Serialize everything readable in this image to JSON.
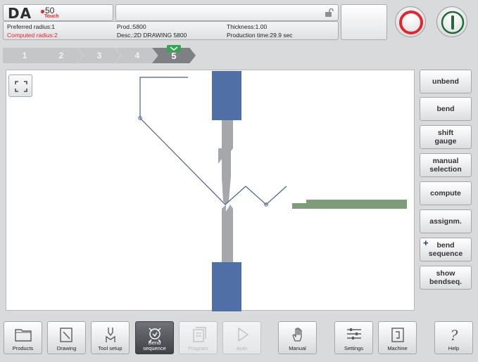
{
  "header": {
    "logo": {
      "brand": "DA",
      "model": "50",
      "sub": "Touch"
    },
    "info": {
      "preferred_radius": "Preferred radius:1",
      "computed_radius": "Computed radius:2",
      "prod": "Prod.:5800",
      "desc": "Desc.:2D DRAWING 5800",
      "thickness": "Thickness:1.00",
      "production_time": "Production time:29.9 sec"
    },
    "colors": {
      "stop": "#e3262b",
      "start": "#1f6b35"
    }
  },
  "steps": [
    {
      "label": "1"
    },
    {
      "label": "2"
    },
    {
      "label": "3"
    },
    {
      "label": "4"
    },
    {
      "label": "5",
      "active": true
    }
  ],
  "side_buttons": {
    "unbend": "unbend",
    "bend": "bend",
    "shift_gauge": "shift\ngauge",
    "manual_selection": "manual\nselection",
    "compute": "compute",
    "assignm": "assignm.",
    "bend_sequence": "bend\nsequence",
    "show_bendseq": "show\nbendseq."
  },
  "toolbar": [
    {
      "label": "Products",
      "icon": "folder-icon"
    },
    {
      "label": "Drawing",
      "icon": "drawing-icon"
    },
    {
      "label": "Tool setup",
      "icon": "tool-setup-icon"
    },
    {
      "label": "Bend\nsequence",
      "icon": "bend-sequence-icon",
      "active": true
    },
    {
      "label": "Program",
      "icon": "program-icon",
      "disabled": true
    },
    {
      "label": "Auto",
      "icon": "play-icon",
      "disabled": true
    },
    {
      "label": "Manual",
      "icon": "hand-icon"
    },
    {
      "label": "Settings",
      "icon": "settings-icon"
    },
    {
      "label": "Machine",
      "icon": "machine-icon"
    },
    {
      "label": "Help",
      "icon": "help-icon"
    }
  ]
}
